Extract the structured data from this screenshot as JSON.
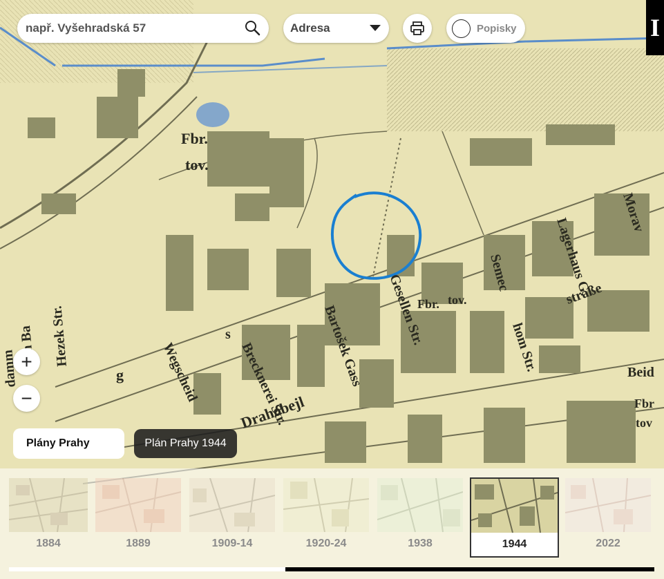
{
  "search": {
    "placeholder": "např. Vyšehradská 57",
    "icon": "search-icon"
  },
  "search_type": {
    "selected": "Adresa"
  },
  "print": {
    "icon": "printer-icon"
  },
  "labels_toggle": {
    "label": "Popisky",
    "checked": false
  },
  "info": {
    "label": "I"
  },
  "zoom": {
    "in_label": "+",
    "out_label": "−"
  },
  "layer": {
    "button_label": "Plány Prahy",
    "current_label": "Plán Prahy 1944"
  },
  "map_labels": [
    "Fbr.",
    "tov.",
    "Hezek Str.",
    "Am Ba",
    "damm",
    "Wegscheid",
    "Brecknerei Str.",
    "Bartošek Gass",
    "Drahobejl",
    "Gesellen Str.",
    "Fbr.",
    "tov.",
    "Semec",
    "Lagerhaus G.",
    "Morav",
    "straße",
    "hom Str.",
    "Beid",
    "Fbr",
    "tov",
    "s",
    "g"
  ],
  "timeline": {
    "active": "1944",
    "items": [
      {
        "year": "1884"
      },
      {
        "year": "1889"
      },
      {
        "year": "1909-14"
      },
      {
        "year": "1920-24"
      },
      {
        "year": "1938"
      },
      {
        "year": "1944"
      },
      {
        "year": "2022"
      }
    ]
  },
  "colors": {
    "map_paper": "#e9e3b5",
    "map_building": "#8f8f68",
    "marker": "#1a7fd1",
    "river": "#4a86c8"
  }
}
